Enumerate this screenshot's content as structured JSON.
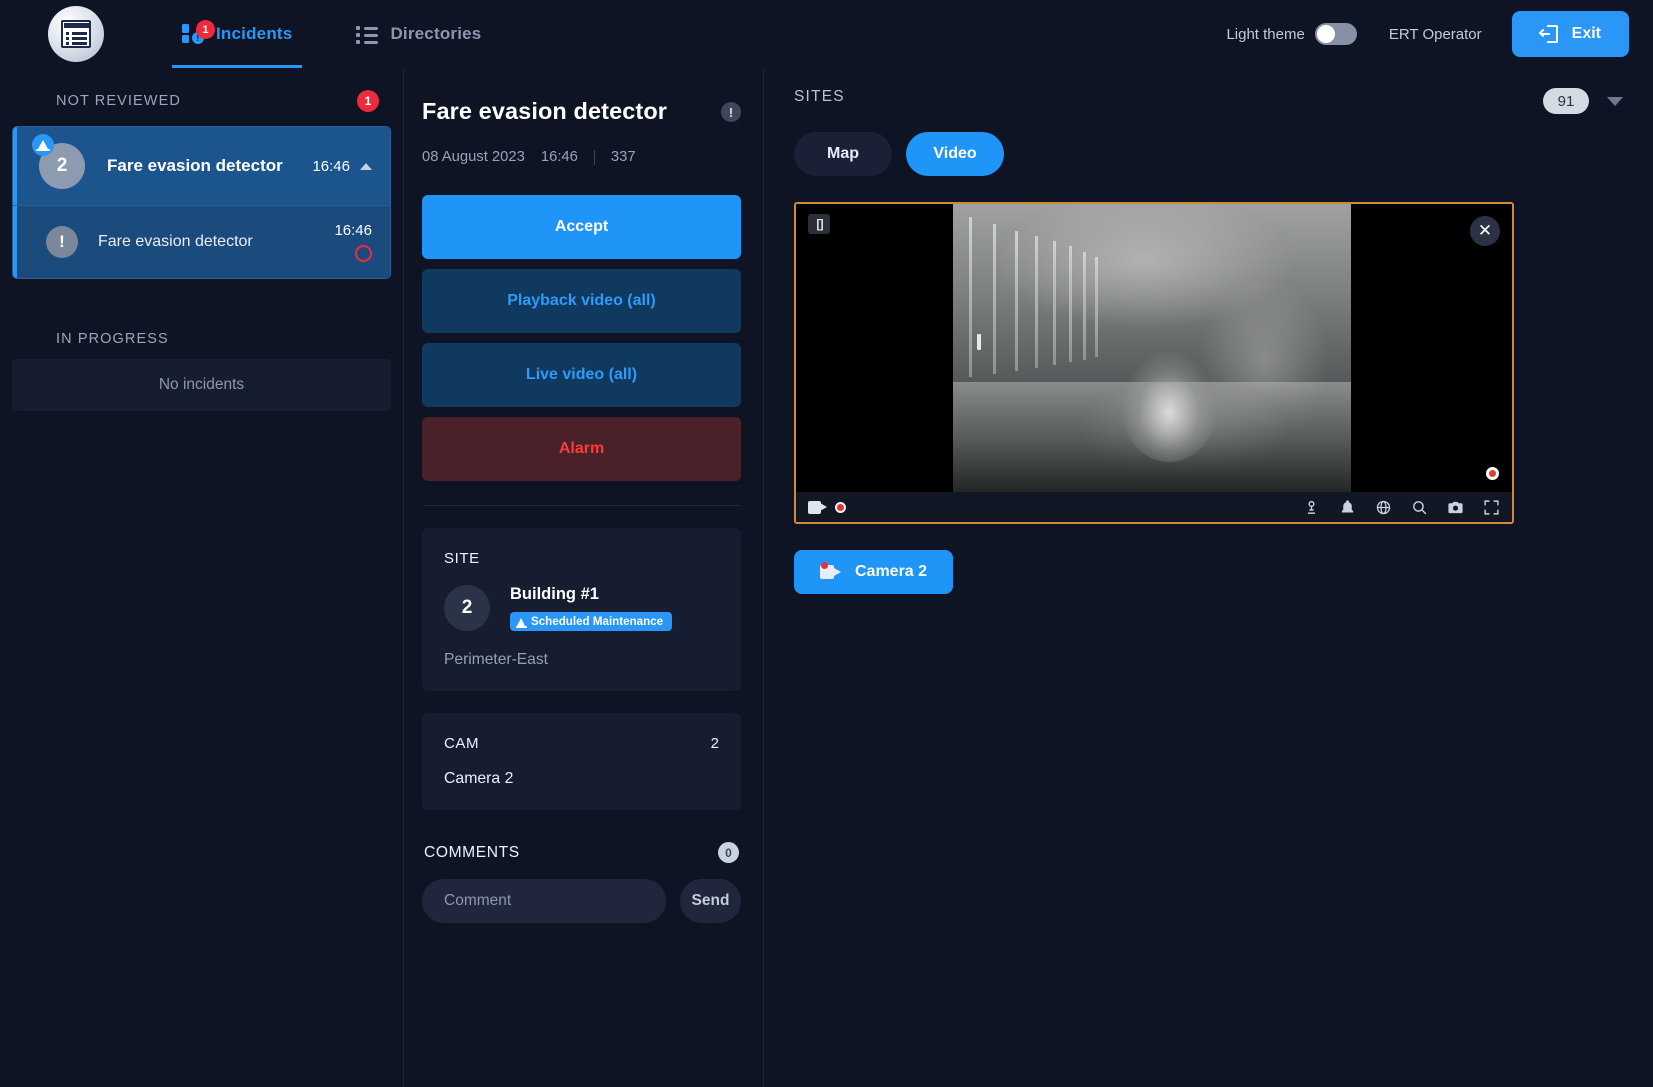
{
  "header": {
    "logo_icon": "app-logo-icon",
    "nav": [
      {
        "label": "Incidents",
        "badge": "1",
        "icon": "incidents-icon",
        "active": true
      },
      {
        "label": "Directories",
        "icon": "directories-list-icon",
        "active": false
      }
    ],
    "theme_label": "Light theme",
    "theme_on": false,
    "user": "ERT Operator",
    "exit_label": "Exit",
    "exit_icon": "exit-door-icon"
  },
  "sidebar": {
    "groups": [
      {
        "title": "NOT REVIEWED",
        "count": "1",
        "items": [
          {
            "avatar": "2",
            "title": "Fare evasion detector",
            "time": "16:46",
            "selected": true,
            "has_maintenance_chip": true,
            "chevron": "chevron-up-icon"
          },
          {
            "avatar": "!",
            "title": "Fare evasion detector",
            "time": "16:46",
            "selected": false,
            "has_maintenance_chip": false,
            "status_ring": "alarm-ring"
          }
        ]
      },
      {
        "title": "IN PROGRESS",
        "empty_text": "No incidents"
      }
    ]
  },
  "detail": {
    "title": "Fare evasion detector",
    "info_glyph": "!",
    "date": "08 August 2023",
    "time": "16:46",
    "id": "337",
    "buttons": {
      "accept": "Accept",
      "playback": "Playback video (all)",
      "live": "Live video (all)",
      "alarm": "Alarm"
    },
    "site_card": {
      "label": "SITE",
      "avatar": "2",
      "name": "Building #1",
      "tag": "Scheduled Maintenance",
      "tag_icon": "maintenance-cone-icon",
      "zone": "Perimeter-East"
    },
    "cam_card": {
      "label": "CAM",
      "count": "2",
      "name": "Camera 2"
    },
    "comments": {
      "label": "COMMENTS",
      "count": "0",
      "placeholder": "Comment",
      "value": "",
      "send_label": "Send"
    }
  },
  "sites": {
    "label": "SITES",
    "counter": "91",
    "dropdown_icon": "chevron-down-icon",
    "tabs": [
      {
        "label": "Map",
        "active": false
      },
      {
        "label": "Video",
        "active": true
      }
    ],
    "player": {
      "expand_icon": "expand-corners-icon",
      "close_icon": "close-icon",
      "camera_icon": "video-camera-icon",
      "recording_icon": "record-dot-icon",
      "controls": [
        "ptz-joystick-icon",
        "bell-icon",
        "wiper-icon",
        "search-icon",
        "snapshot-camera-icon",
        "fullscreen-icon"
      ]
    },
    "camera_chip": {
      "label": "Camera 2",
      "icon": "video-camera-record-icon"
    }
  },
  "colors": {
    "accent": "#2a96f6",
    "danger": "#ee2b3b",
    "alarm_bg": "#4a2128",
    "alarm_text": "#fd3a3a",
    "panel": "#161d31",
    "background": "#0e1424",
    "video_border": "#d08a3a"
  }
}
